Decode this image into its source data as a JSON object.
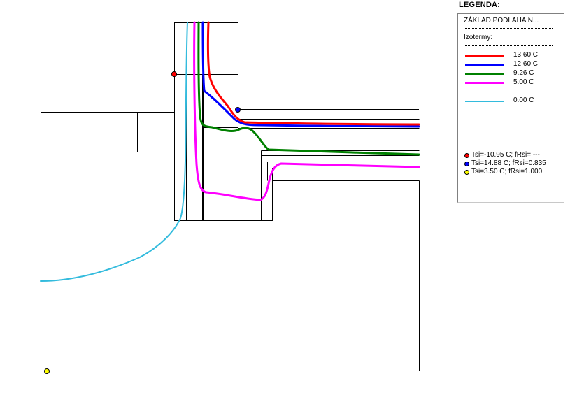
{
  "legend": {
    "heading": "LEGENDA:",
    "title": "ZÁKLAD PODLAHA N...",
    "isotherms_label": "Izotermy:",
    "isotherms": [
      {
        "value": "13.60 C",
        "color": "#ff0000"
      },
      {
        "value": "12.60 C",
        "color": "#0000ff"
      },
      {
        "value": "9.26 C",
        "color": "#008000"
      },
      {
        "value": "5.00 C",
        "color": "#ff00ff"
      },
      {
        "value": "0.00 C",
        "color": "#33bbdd"
      }
    ],
    "points": [
      {
        "text": "Tsi=-10.95 C; fRsi= ---",
        "color": "#ff0000"
      },
      {
        "text": "Tsi=14.88 C; fRsi=0.835",
        "color": "#0000ff"
      },
      {
        "text": "Tsi=3.50 C; fRsi=1.000",
        "color": "#ffff00"
      }
    ]
  }
}
